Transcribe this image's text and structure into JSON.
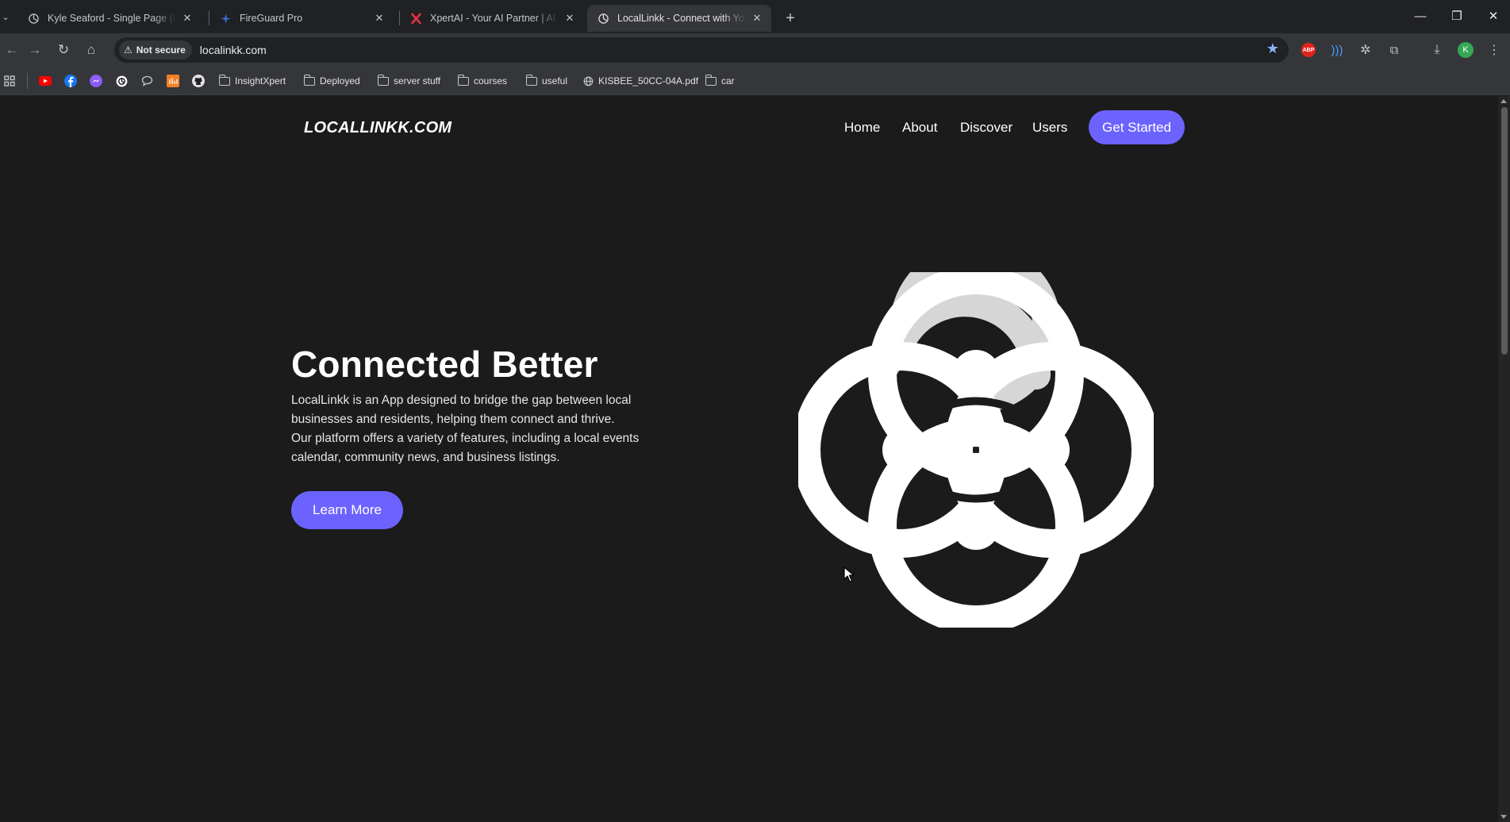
{
  "browser": {
    "tabs": [
      {
        "title": "Kyle Seaford - Single Page (Dark",
        "active": false
      },
      {
        "title": "FireGuard Pro",
        "active": false
      },
      {
        "title": "XpertAI - Your AI Partner | AI Ch",
        "active": false
      },
      {
        "title": "LocalLinkk - Connect with Your L",
        "active": true
      }
    ],
    "security_label": "Not secure",
    "url": "localinkk.com",
    "profile_initial": "K",
    "abp_label": "ABP",
    "bookmarks": [
      {
        "label": "InsightXpert",
        "type": "folder"
      },
      {
        "label": "Deployed",
        "type": "folder"
      },
      {
        "label": "server stuff",
        "type": "folder"
      },
      {
        "label": "courses",
        "type": "folder"
      },
      {
        "label": "useful",
        "type": "folder"
      },
      {
        "label": "KISBEE_50CC-04A.pdf",
        "type": "link"
      },
      {
        "label": "car",
        "type": "folder"
      }
    ]
  },
  "site": {
    "logo": "LOCALLINKK.COM",
    "nav": [
      "Home",
      "About",
      "Discover",
      "Users"
    ],
    "cta_label": "Get Started",
    "hero": {
      "title": "Connected Better",
      "line1": "LocalLinkk is an App designed to bridge the gap between local",
      "line2": "businesses and residents, helping them connect and thrive.",
      "line3": "Our platform offers a variety of features, including a local events",
      "line4": "calendar, community news, and business listings.",
      "button_label": "Learn More"
    }
  },
  "colors": {
    "accent": "#6c63ff",
    "page_bg": "#1b1b1b",
    "chrome_bg": "#202124",
    "toolbar_bg": "#35363a"
  },
  "icons": {
    "hero": "interlocking-rings-logo-icon",
    "tab_favicons": [
      "openai-icon",
      "fireguard-icon",
      "xpertai-x-icon",
      "openai-icon"
    ]
  }
}
